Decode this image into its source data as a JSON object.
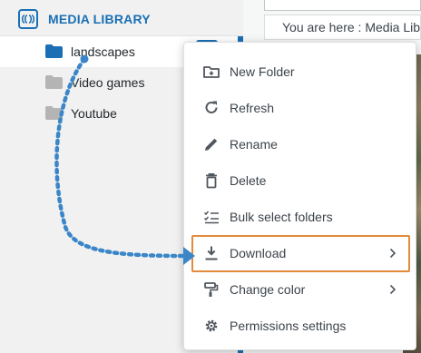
{
  "sidebar": {
    "title": "MEDIA LIBRARY",
    "folders": [
      {
        "label": "landscapes",
        "color": "#1a6fb5",
        "active": true
      },
      {
        "label": "Video games",
        "color": "#b4b4b4",
        "active": false
      },
      {
        "label": "Youtube",
        "color": "#b4b4b4",
        "active": false
      }
    ]
  },
  "breadcrumb": {
    "text": "You are here  :  Media Library"
  },
  "context_menu": {
    "items": [
      {
        "label": "New Folder",
        "icon": "new-folder-icon"
      },
      {
        "label": "Refresh",
        "icon": "refresh-icon"
      },
      {
        "label": "Rename",
        "icon": "pencil-icon"
      },
      {
        "label": "Delete",
        "icon": "trash-icon"
      },
      {
        "label": "Bulk select folders",
        "icon": "checklist-icon"
      },
      {
        "label": "Download",
        "icon": "download-icon",
        "has_submenu": true,
        "highlighted": true
      },
      {
        "label": "Change color",
        "icon": "paint-roller-icon",
        "has_submenu": true
      },
      {
        "label": "Permissions settings",
        "icon": "gear-icon"
      }
    ]
  },
  "colors": {
    "accent": "#1a6fb5",
    "highlight": "#e38a3b",
    "arrow": "#3a86c8"
  }
}
